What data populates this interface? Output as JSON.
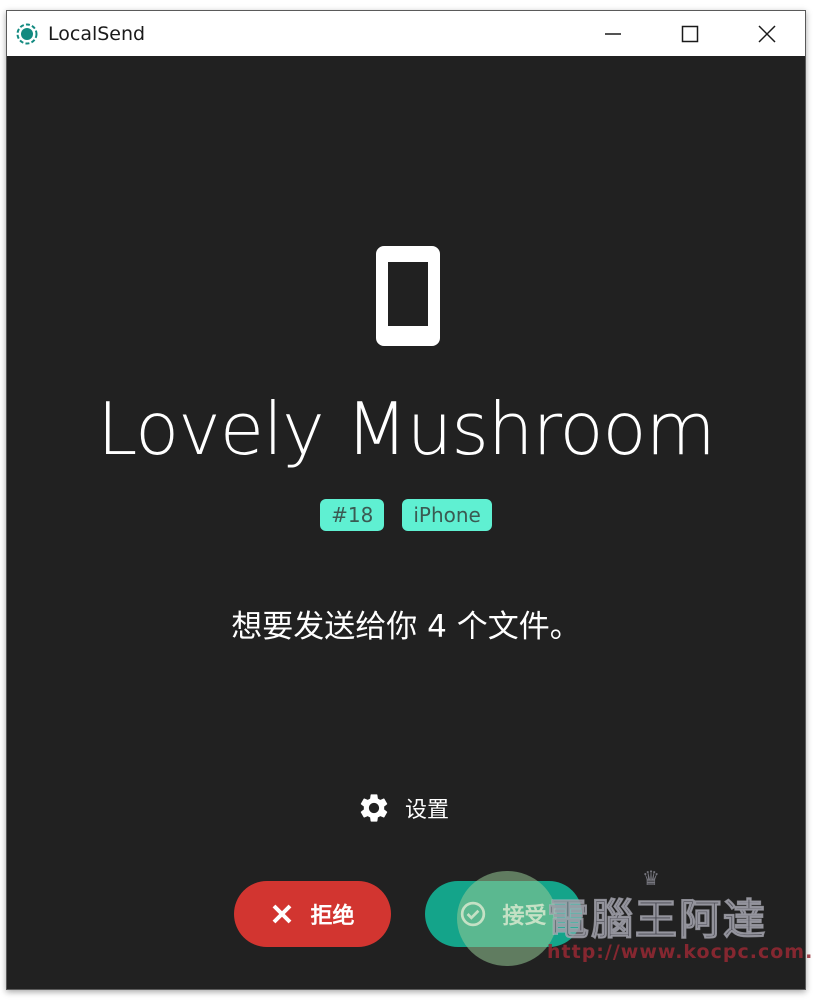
{
  "window": {
    "title": "LocalSend",
    "icon": "localsend-logo-icon",
    "controls": {
      "minimize": "minimize-icon",
      "maximize": "maximize-icon",
      "close": "close-icon"
    }
  },
  "request": {
    "device_icon": "smartphone-icon",
    "device_name": "Lovely Mushroom",
    "badges": [
      "#18",
      "iPhone"
    ],
    "message": "想要发送给你 4 个文件。"
  },
  "settings": {
    "icon": "gear-icon",
    "label": "设置"
  },
  "actions": {
    "decline": {
      "label": "拒绝",
      "icon": "close-icon",
      "color": "#d23530"
    },
    "accept": {
      "label": "接受",
      "icon": "check-circle-icon",
      "color": "#14a48a"
    }
  },
  "watermark": {
    "title": "電腦王阿達",
    "url": "http://www.kocpc.com.tw"
  },
  "colors": {
    "background": "#212121",
    "badge": "#5ff0d2",
    "accent": "#128a80"
  }
}
